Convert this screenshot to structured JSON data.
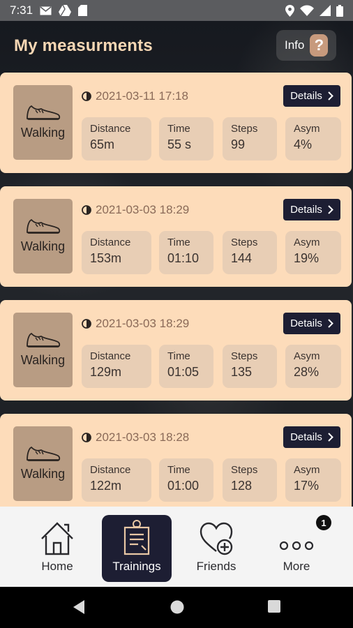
{
  "status_bar": {
    "time": "7:31"
  },
  "header": {
    "title": "My measurments",
    "info_label": "Info",
    "info_icon": "?"
  },
  "colors": {
    "accent": "#1d1e33",
    "card": "#fddcba",
    "activity_box": "#b89c83",
    "stat_box": "#e8ceb5",
    "title": "#f6d7b4"
  },
  "measurements": [
    {
      "activity": "Walking",
      "datetime": "2021-03-11 17:18",
      "details_label": "Details",
      "stats": [
        {
          "label": "Distance",
          "value": "65m"
        },
        {
          "label": "Time",
          "value": "55 s"
        },
        {
          "label": "Steps",
          "value": "99"
        },
        {
          "label": "Asym",
          "value": "4%"
        }
      ]
    },
    {
      "activity": "Walking",
      "datetime": "2021-03-03 18:29",
      "details_label": "Details",
      "stats": [
        {
          "label": "Distance",
          "value": "153m"
        },
        {
          "label": "Time",
          "value": "01:10"
        },
        {
          "label": "Steps",
          "value": "144"
        },
        {
          "label": "Asym",
          "value": "19%"
        }
      ]
    },
    {
      "activity": "Walking",
      "datetime": "2021-03-03 18:29",
      "details_label": "Details",
      "stats": [
        {
          "label": "Distance",
          "value": "129m"
        },
        {
          "label": "Time",
          "value": "01:05"
        },
        {
          "label": "Steps",
          "value": "135"
        },
        {
          "label": "Asym",
          "value": "28%"
        }
      ]
    },
    {
      "activity": "Walking",
      "datetime": "2021-03-03 18:28",
      "details_label": "Details",
      "stats": [
        {
          "label": "Distance",
          "value": "122m"
        },
        {
          "label": "Time",
          "value": "01:00"
        },
        {
          "label": "Steps",
          "value": "128"
        },
        {
          "label": "Asym",
          "value": "17%"
        }
      ]
    }
  ],
  "bottom_nav": {
    "items": [
      {
        "label": "Home",
        "icon": "home-icon"
      },
      {
        "label": "Trainings",
        "icon": "clipboard-icon",
        "active": true
      },
      {
        "label": "Friends",
        "icon": "heart-plus-icon"
      },
      {
        "label": "More",
        "icon": "more-dots-icon",
        "badge": "1"
      }
    ]
  }
}
